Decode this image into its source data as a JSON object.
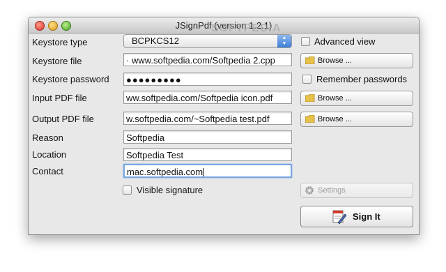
{
  "window": {
    "title": "JSignPdf (version 1.2.1)",
    "watermark": "SOFTPEDIA"
  },
  "labels": {
    "keystore_type": "Keystore type",
    "keystore_file": "Keystore file",
    "keystore_password": "Keystore password",
    "input_pdf": "Input PDF file",
    "output_pdf": "Output PDF file",
    "reason": "Reason",
    "location": "Location",
    "contact": "Contact"
  },
  "fields": {
    "keystore_type": "BCPKCS12",
    "keystore_file": "· www.softpedia.com/Softpedia 2.cpp",
    "keystore_password": "●●●●●●●●●",
    "input_pdf": "ww.softpedia.com/Softpedia icon.pdf",
    "output_pdf": "w.softpedia.com/~Softpedia test.pdf",
    "reason": "Softpedia",
    "location": "Softpedia Test",
    "contact": "mac.softpedia.com"
  },
  "checks": {
    "advanced_view": "Advanced view",
    "remember_passwords": "Remember passwords",
    "visible_signature": "Visible signature"
  },
  "buttons": {
    "browse": "Browse ...",
    "settings": "Settings",
    "sign": "Sign It"
  },
  "icons": {
    "folder": "folder-icon",
    "gear": "gear-icon",
    "pen": "pen-icon"
  },
  "colors": {
    "folder": "#e7c24a",
    "combo_arrows": "#3d7fd8",
    "focus": "#7aa7e0"
  }
}
